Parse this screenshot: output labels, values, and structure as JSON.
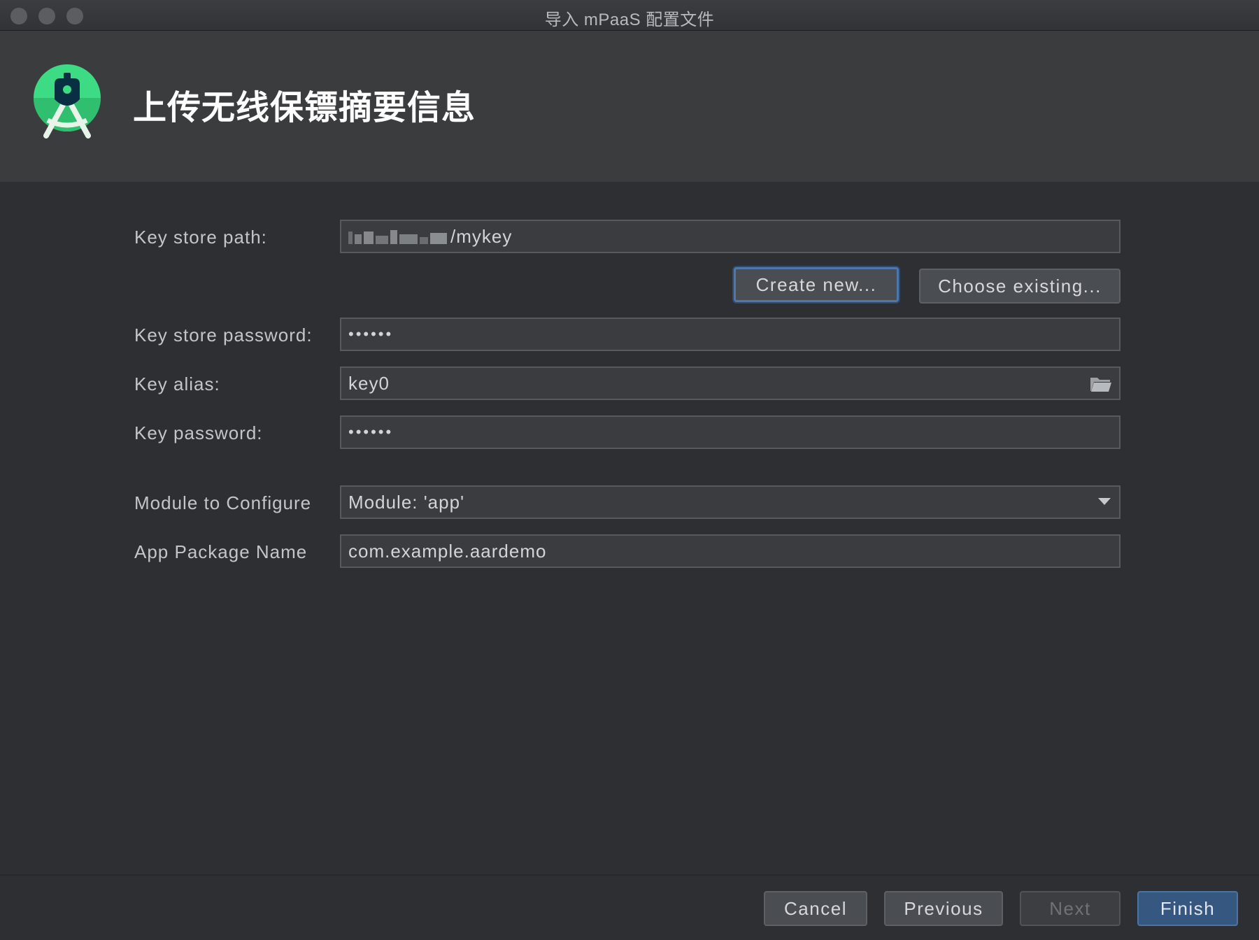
{
  "window": {
    "title": "导入 mPaaS 配置文件"
  },
  "header": {
    "title": "上传无线保镖摘要信息",
    "logo": "android-studio-logo-icon"
  },
  "form": {
    "keystore_path": {
      "label": "Key store path:",
      "value": "/mykey"
    },
    "create_new_label": "Create new...",
    "choose_existing_label": "Choose existing...",
    "keystore_password": {
      "label": "Key store password:",
      "value": "••••••"
    },
    "key_alias": {
      "label": "Key alias:",
      "value": "key0",
      "icon": "folder-icon"
    },
    "key_password": {
      "label": "Key password:",
      "value": "••••••"
    },
    "module": {
      "label": "Module to Configure",
      "value": "Module: 'app'",
      "icon": "chevron-down-icon"
    },
    "package": {
      "label": "App Package Name",
      "value": "com.example.aardemo"
    }
  },
  "footer": {
    "cancel_label": "Cancel",
    "previous_label": "Previous",
    "next_label": "Next",
    "finish_label": "Finish"
  },
  "colors": {
    "background": "#2d2f32",
    "header": "#3b3c3e",
    "accent": "#365880",
    "logo_green": "#3ddc84"
  }
}
